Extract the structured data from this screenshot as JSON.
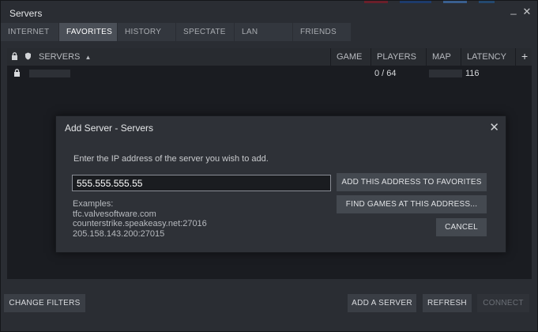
{
  "window": {
    "title": "Servers",
    "minimize": "_",
    "close": "✕"
  },
  "tabs": [
    {
      "label": "INTERNET"
    },
    {
      "label": "FAVORITES",
      "active": true
    },
    {
      "label": "HISTORY"
    },
    {
      "label": "SPECTATE"
    },
    {
      "label": "LAN"
    },
    {
      "label": "FRIENDS"
    }
  ],
  "list": {
    "columns": {
      "servers": "SERVERS",
      "sort_indicator": "▲",
      "game": "GAME",
      "players": "PLAYERS",
      "map": "MAP",
      "latency": "LATENCY",
      "add": "+"
    },
    "rows": [
      {
        "players": "0 / 64",
        "latency": "116"
      }
    ]
  },
  "footer": {
    "change_filters": "CHANGE FILTERS",
    "add_server": "ADD A SERVER",
    "refresh": "REFRESH",
    "connect": "CONNECT"
  },
  "dialog": {
    "title": "Add Server - Servers",
    "close": "✕",
    "prompt": "Enter the IP address of the server you wish to add.",
    "input_value": "555.555.555.55",
    "examples_label": "Examples:",
    "examples": [
      "tfc.valvesoftware.com",
      "counterstrike.speakeasy.net:27016",
      "205.158.143.200:27015"
    ],
    "add_favorites": "ADD THIS ADDRESS TO FAVORITES",
    "find_games": "FIND GAMES AT THIS ADDRESS...",
    "cancel": "CANCEL"
  },
  "colors": {
    "background": "#2a2d33",
    "list_bg": "#1a1c21",
    "active_tab": "#4a4f57",
    "button": "#3a3e45"
  }
}
